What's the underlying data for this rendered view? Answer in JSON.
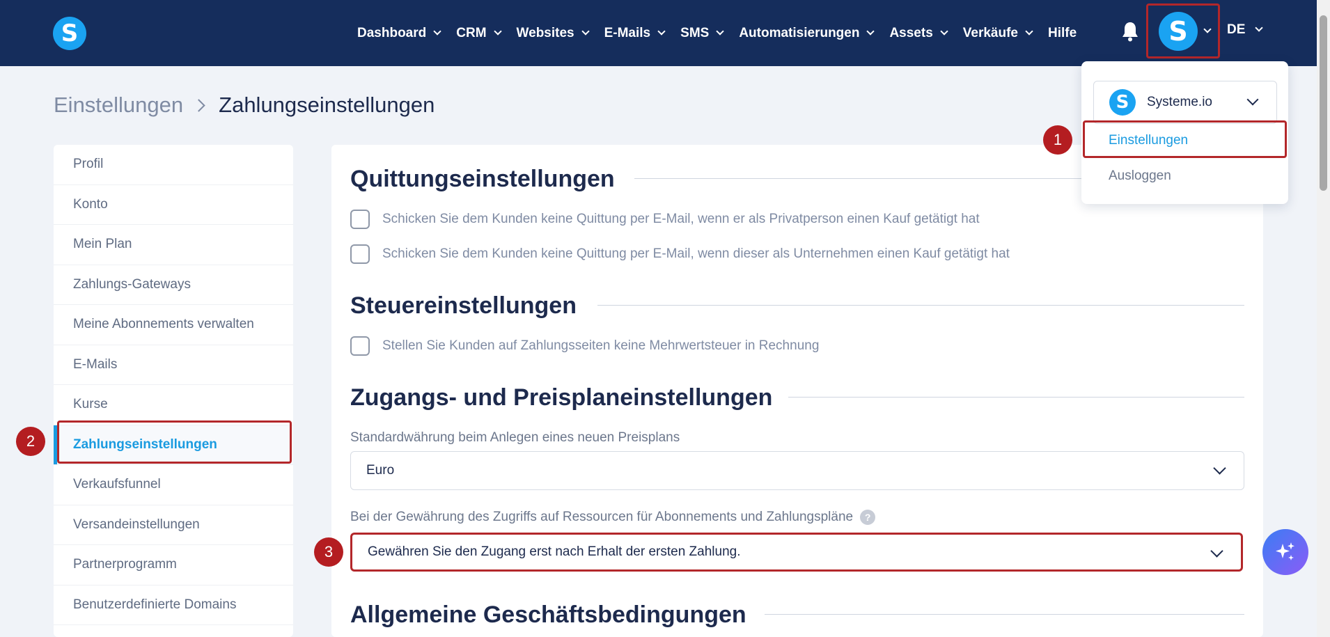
{
  "nav": {
    "logo": "S",
    "items": [
      {
        "label": "Dashboard",
        "has_dropdown": true
      },
      {
        "label": "CRM",
        "has_dropdown": true
      },
      {
        "label": "Websites",
        "has_dropdown": true
      },
      {
        "label": "E-Mails",
        "has_dropdown": true
      },
      {
        "label": "SMS",
        "has_dropdown": true
      },
      {
        "label": "Automatisierungen",
        "has_dropdown": true
      },
      {
        "label": "Assets",
        "has_dropdown": true
      },
      {
        "label": "Verkäufe",
        "has_dropdown": true
      },
      {
        "label": "Hilfe",
        "has_dropdown": false
      }
    ],
    "avatar_letter": "S",
    "language": "DE"
  },
  "breadcrumb": {
    "parent": "Einstellungen",
    "current": "Zahlungseinstellungen"
  },
  "sidebar": {
    "items": [
      {
        "label": "Profil"
      },
      {
        "label": "Konto"
      },
      {
        "label": "Mein Plan"
      },
      {
        "label": "Zahlungs-Gateways"
      },
      {
        "label": "Meine Abonnements verwalten"
      },
      {
        "label": "E-Mails"
      },
      {
        "label": "Kurse"
      },
      {
        "label": "Zahlungseinstellungen",
        "active": true
      },
      {
        "label": "Verkaufsfunnel"
      },
      {
        "label": "Versandeinstellungen"
      },
      {
        "label": "Partnerprogramm"
      },
      {
        "label": "Benutzerdefinierte Domains"
      }
    ]
  },
  "receipt": {
    "title": "Quittungseinstellungen",
    "options": [
      "Schicken Sie dem Kunden keine Quittung per E-Mail, wenn er als Privatperson einen Kauf getätigt hat",
      "Schicken Sie dem Kunden keine Quittung per E-Mail, wenn dieser als Unternehmen einen Kauf getätigt hat"
    ]
  },
  "tax": {
    "title": "Steuereinstellungen",
    "option": "Stellen Sie Kunden auf Zahlungsseiten keine Mehrwertsteuer in Rechnung"
  },
  "access": {
    "title": "Zugangs- und Preisplaneinstellungen",
    "currency_label": "Standardwährung beim Anlegen eines neuen Preisplans",
    "currency_value": "Euro",
    "grant_label": "Bei der Gewährung des Zugriffs auf Ressourcen für Abonnements und Zahlungspläne",
    "grant_help": "?",
    "grant_value": "Gewähren Sie den Zugang erst nach Erhalt der ersten Zahlung."
  },
  "terms": {
    "title": "Allgemeine Geschäftsbedingungen"
  },
  "account_menu": {
    "account_name": "Systeme.io",
    "account_logo": "S",
    "settings": "Einstellungen",
    "logout": "Ausloggen"
  },
  "annotations": {
    "step1": "1",
    "step2": "2",
    "step3": "3"
  },
  "colors": {
    "nav_bg": "#152d5c",
    "brand_blue": "#1aa3f2",
    "accent": "#1a9be0",
    "highlight_red": "#b3272a"
  }
}
